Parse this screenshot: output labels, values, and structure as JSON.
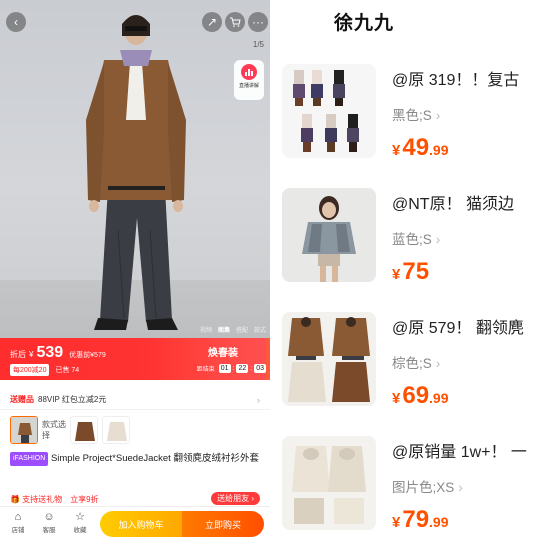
{
  "product_page": {
    "pagination": "1/5",
    "live_label": "直播讲解",
    "gallery_tabs": [
      "视频",
      "图集",
      "搭配",
      "款式"
    ],
    "price_bar": {
      "after_label": "折后",
      "currency": "¥",
      "price": "539",
      "original": "优惠前¥579",
      "coupon": "每200减20",
      "sold": "已售 74",
      "event_title": "焕春装",
      "timer_label": "距结束",
      "timer": [
        "01",
        "22",
        "03"
      ]
    },
    "gift": {
      "tag": "送赠品",
      "text": "88VIP 红包立减2元",
      "arrow": "›"
    },
    "variants": {
      "label": "款式选择"
    },
    "title": {
      "brand": "iFASHION",
      "text": "Simple Project*SuedeJacket 翻领麂皮绒衬衫外套"
    },
    "promo": {
      "p1": "🎁 支持送礼物",
      "p2": "立享9折",
      "button": "送给朋友 ›"
    },
    "bottom_bar": {
      "icons": [
        {
          "name": "store-icon",
          "glyph": "⌂",
          "label": "店铺"
        },
        {
          "name": "service-icon",
          "glyph": "☺",
          "label": "客服"
        },
        {
          "name": "favorite-icon",
          "glyph": "☆",
          "label": "收藏"
        }
      ],
      "add_to_cart": "加入购物车",
      "buy_now": "立即购买"
    }
  },
  "shop": {
    "name": "徐九九",
    "items": [
      {
        "title": "@原 319！！复古",
        "spec": "黑色;S",
        "currency": "¥",
        "price_int": "49",
        "price_dec": ".99"
      },
      {
        "title": "@NT原！ 猫须边",
        "spec": "蓝色;S",
        "currency": "¥",
        "price_int": "75",
        "price_dec": ""
      },
      {
        "title": "@原 579！ 翻领麂",
        "spec": "棕色;S",
        "currency": "¥",
        "price_int": "69",
        "price_dec": ".99"
      },
      {
        "title": "@原销量 1w+！ 一",
        "spec": "图片色;XS",
        "currency": "¥",
        "price_int": "79",
        "price_dec": ".99"
      }
    ]
  },
  "colors": {
    "accent_red": "#ff2d2d",
    "price_orange": "#ff5000",
    "cart_yellow": "#ffb400",
    "buy_orange": "#ff5a00"
  }
}
